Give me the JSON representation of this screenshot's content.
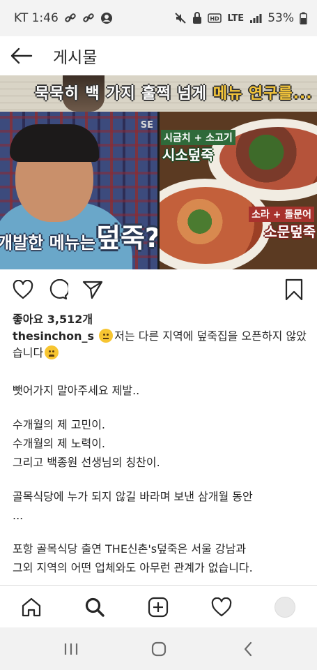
{
  "status_bar": {
    "carrier_time": "KT 1:46",
    "network": "LTE",
    "battery": "53%"
  },
  "header": {
    "title": "게시물"
  },
  "media": {
    "top_subtitle_a": "묵묵히 백 가지 훌쩍 넘게 ",
    "top_subtitle_b": "메뉴 연구를...",
    "left_subtitle_small": "개발한 메뉴는",
    "left_subtitle_big": "덮죽?",
    "left_watermark": "SE",
    "right_tag_top_small": "시금치 + 소고기",
    "right_tag_top_big": "시소덮죽",
    "right_tag_bottom_small": "소라 + 돌문어",
    "right_tag_bottom_big": "소문덮죽"
  },
  "post": {
    "likes": "좋아요 3,512개",
    "username": "thesinchon_s",
    "caption_first": "저는 다른 지역에 덮죽집을 오픈하지 않았습니다",
    "para1": "뺏어가지 말아주세요 제발..",
    "para2_lines": [
      "수개월의 제 고민이.",
      "수개월의 제 노력이.",
      "그리고 백종원 선생님의 칭찬이."
    ],
    "para3_lines": [
      "골목식당에 누가 되지 않길 바라며 보낸 삼개월 동안",
      "..."
    ],
    "para4_lines": [
      "포항 골목식당 출연 THE신촌's덮죽은 서울 강남과",
      "그외 지역의 어떤 업체와도 아무런 관계가 없습니다."
    ]
  },
  "colors": {
    "text": "#262626",
    "status_bg": "#f3f3f3",
    "nav_bg": "#f2f2f2",
    "highlight_yellow": "#f5c63a"
  }
}
